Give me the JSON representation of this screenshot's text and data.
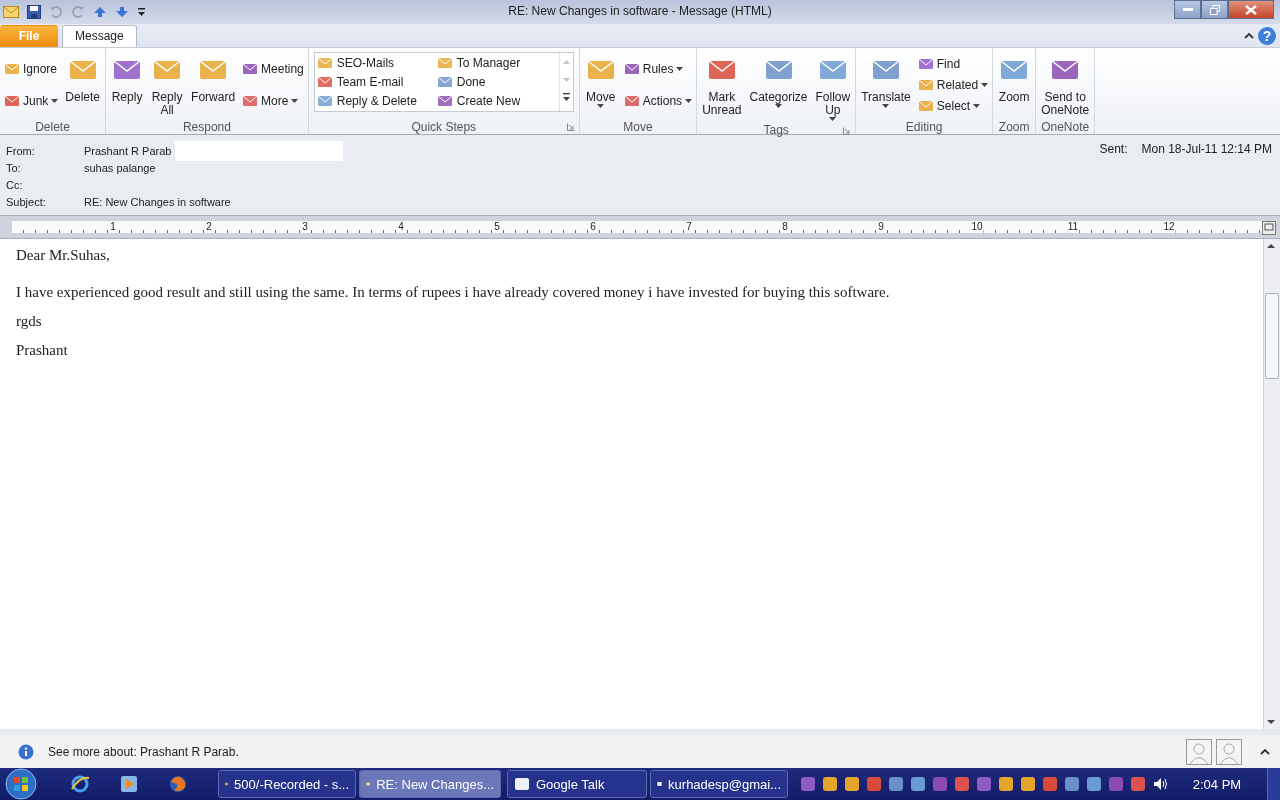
{
  "window": {
    "title": "RE: New Changes in software  -  Message (HTML)",
    "help": "?"
  },
  "tabs": [
    {
      "label": "File",
      "kind": "file",
      "selected": false
    },
    {
      "label": "Message",
      "kind": "tab",
      "selected": true
    }
  ],
  "ribbon": [
    {
      "label": "Delete",
      "kind": "buttons",
      "launcher": false,
      "items": [
        {
          "lines": [
            "Ignore"
          ],
          "kind": "small",
          "dropdown": false
        },
        {
          "lines": [
            "Junk"
          ],
          "kind": "small",
          "dropdown": true
        },
        {
          "lines": [
            "Delete"
          ],
          "kind": "large",
          "dropdown": false
        }
      ]
    },
    {
      "label": "Respond",
      "kind": "buttons",
      "launcher": false,
      "items": [
        {
          "lines": [
            "Reply"
          ],
          "kind": "large",
          "dropdown": false
        },
        {
          "lines": [
            "Reply",
            "All"
          ],
          "kind": "large",
          "dropdown": false
        },
        {
          "lines": [
            "Forward"
          ],
          "kind": "large",
          "dropdown": false
        },
        {
          "lines": [
            "Meeting"
          ],
          "kind": "small",
          "dropdown": false
        },
        {
          "lines": [
            "More"
          ],
          "kind": "small",
          "dropdown": true
        }
      ]
    },
    {
      "label": "Quick Steps",
      "kind": "gallery",
      "launcher": true,
      "items": [
        {
          "lines": [
            "SEO-Mails"
          ]
        },
        {
          "lines": [
            "To Manager"
          ]
        },
        {
          "lines": [
            "Team E-mail"
          ]
        },
        {
          "lines": [
            "Done"
          ]
        },
        {
          "lines": [
            "Reply & Delete"
          ]
        },
        {
          "lines": [
            "Create New"
          ]
        }
      ]
    },
    {
      "label": "Move",
      "kind": "buttons",
      "launcher": false,
      "items": [
        {
          "lines": [
            "Move"
          ],
          "kind": "large",
          "dropdown": true
        },
        {
          "lines": [
            "Rules"
          ],
          "kind": "small",
          "dropdown": true
        },
        {
          "lines": [
            "Actions"
          ],
          "kind": "small",
          "dropdown": true
        }
      ]
    },
    {
      "label": "Tags",
      "kind": "buttons",
      "launcher": true,
      "items": [
        {
          "lines": [
            "Mark",
            "Unread"
          ],
          "kind": "large",
          "dropdown": false
        },
        {
          "lines": [
            "Categorize"
          ],
          "kind": "large",
          "dropdown": true
        },
        {
          "lines": [
            "Follow",
            "Up"
          ],
          "kind": "large",
          "dropdown": true
        }
      ]
    },
    {
      "label": "Editing",
      "kind": "buttons",
      "launcher": false,
      "items": [
        {
          "lines": [
            "Translate"
          ],
          "kind": "large",
          "dropdown": true
        },
        {
          "lines": [
            "Find"
          ],
          "kind": "small",
          "dropdown": false
        },
        {
          "lines": [
            "Related"
          ],
          "kind": "small",
          "dropdown": true
        },
        {
          "lines": [
            "Select"
          ],
          "kind": "small",
          "dropdown": true
        }
      ]
    },
    {
      "label": "Zoom",
      "kind": "buttons",
      "launcher": false,
      "items": [
        {
          "lines": [
            "Zoom"
          ],
          "kind": "large",
          "dropdown": false
        }
      ]
    },
    {
      "label": "OneNote",
      "kind": "buttons",
      "launcher": false,
      "items": [
        {
          "lines": [
            "Send to",
            "OneNote"
          ],
          "kind": "large",
          "dropdown": false
        }
      ]
    }
  ],
  "header": {
    "fields": [
      {
        "label": "From:",
        "value": "Prashant R Parab",
        "redacted": true
      },
      {
        "label": "To:",
        "value": "suhas palange",
        "redacted": false
      },
      {
        "label": "Cc:",
        "redacted": false
      },
      {
        "label": "Subject:",
        "value": "RE: New Changes in software",
        "redacted": false
      }
    ],
    "sent_label": "Sent:",
    "sent": "Mon 18-Jul-11 12:14 PM"
  },
  "ruler": [
    "1",
    "2",
    "3",
    "4",
    "5",
    "6",
    "7",
    "8",
    "9",
    "10",
    "11",
    "12"
  ],
  "body": [
    "Dear Mr.Suhas,",
    "I have experienced good result and still using the same. In terms of rupees i have already covered money i have invested for buying this software.",
    " rgds",
    " Prashant"
  ],
  "people_pane": {
    "text": "See more about: Prashant R Parab."
  },
  "taskbar": {
    "buttons": [
      {
        "label": "500/-Recorded - s...",
        "selected": false
      },
      {
        "label": "RE: New Changes...",
        "selected": true
      },
      {
        "label": "Google Talk",
        "selected": false
      },
      {
        "label": "kurhadesp@gmai...",
        "selected": false
      }
    ],
    "clock": "2:04 PM"
  }
}
